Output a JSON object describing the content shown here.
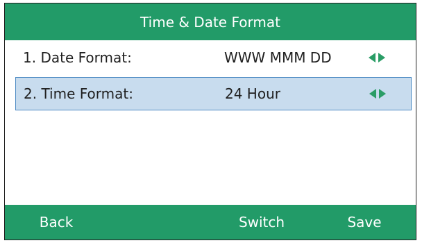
{
  "title": "Time & Date Format",
  "items": [
    {
      "label": "1. Date Format:",
      "value": "WWW MMM DD",
      "selected": false
    },
    {
      "label": "2. Time Format:",
      "value": "24 Hour",
      "selected": true
    }
  ],
  "softkeys": {
    "back": "Back",
    "empty": "",
    "switch": "Switch",
    "save": "Save"
  },
  "colors": {
    "accent_green": "#229b68",
    "arrow_green": "#2a9d66",
    "selected_row_bg": "#c8dcee",
    "selected_row_border": "#4f8cc4"
  },
  "icons": {
    "left_arrow": "left-arrow-icon",
    "right_arrow": "right-arrow-icon"
  }
}
